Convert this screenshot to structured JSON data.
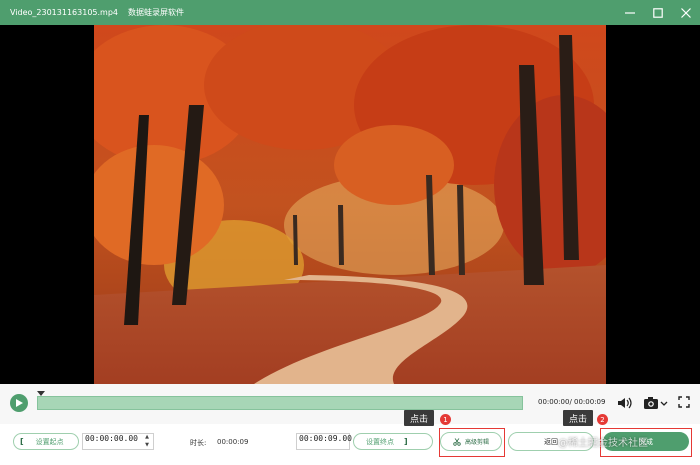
{
  "window": {
    "file_title": "Video_230131163105.mp4",
    "app_title": "数据蛙录屏软件"
  },
  "playback": {
    "time_readout": "00:00:00/ 00:00:09"
  },
  "trim": {
    "set_start_label": "设置起点",
    "start_time": "00:00:00.00",
    "duration_label": "时长:",
    "duration_value": "00:00:09",
    "end_time": "00:00:09.00",
    "set_end_label": "设置终点",
    "bracket_open": "[",
    "bracket_close": "]"
  },
  "actions": {
    "advanced_edit_label": "高级剪辑",
    "back_label": "返回",
    "done_label": "完成"
  },
  "annotations": {
    "tip_1_text": "点击",
    "badge_1": "1",
    "tip_2_text": "点击",
    "badge_2": "2",
    "highlight_color": "#e53935"
  },
  "watermark": "@稀土掘金技术社区",
  "colors": {
    "accent": "#4f9e6e",
    "track_fill": "#a7d6b6"
  }
}
